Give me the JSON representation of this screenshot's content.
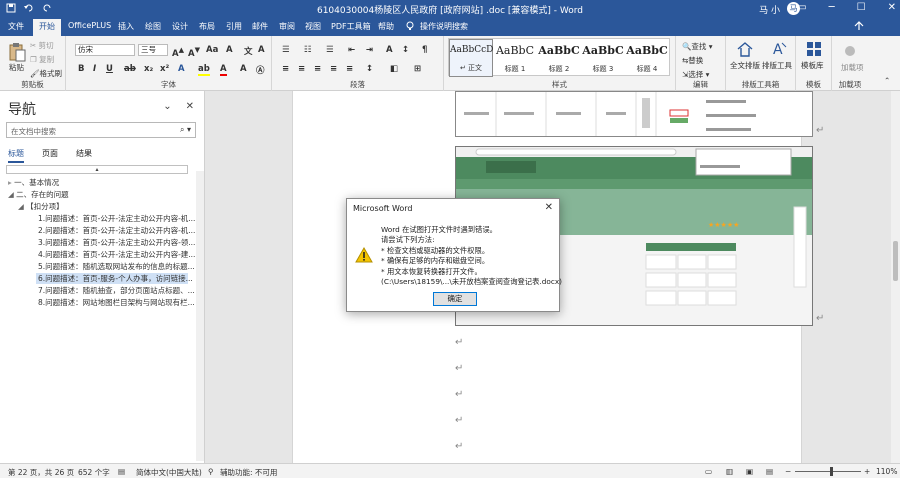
{
  "window": {
    "title": "6104030004杨陵区人民政府 [政府网站] .doc [兼容模式] - Word",
    "user": "马 小",
    "user_initial": "马"
  },
  "ribbon_tabs": [
    "文件",
    "开始",
    "OfficePLUS",
    "插入",
    "绘图",
    "设计",
    "布局",
    "引用",
    "邮件",
    "审阅",
    "视图",
    "PDF工具箱",
    "帮助",
    "操作说明搜索"
  ],
  "ribbon": {
    "clipboard": {
      "paste": "粘贴",
      "cut": "剪切",
      "copy": "复制",
      "format_painter": "格式刷",
      "label": "剪贴板"
    },
    "font": {
      "font_name": "仿宋",
      "font_size": "三号",
      "label": "字体"
    },
    "paragraph": {
      "label": "段落"
    },
    "styles": {
      "label": "样式",
      "items": [
        {
          "sample": "AaBbCcD",
          "name": "↵ 正文"
        },
        {
          "sample": "AaBbC",
          "name": "标题 1"
        },
        {
          "sample": "AaBbC",
          "name": "标题 2"
        },
        {
          "sample": "AaBbC",
          "name": "标题 3"
        },
        {
          "sample": "AaBbC",
          "name": "标题 4"
        }
      ]
    },
    "editing": {
      "find": "查找",
      "replace": "替换",
      "select": "选择",
      "label": "编辑"
    },
    "layout_tools": {
      "full_layout": "全文排版",
      "layout_tool": "排版工具",
      "label": "排版工具箱"
    },
    "template": {
      "template_lib": "模板库",
      "label": "模板"
    },
    "addins": {
      "load_item": "加载项",
      "label": "加载项"
    }
  },
  "nav": {
    "title": "导航",
    "search_placeholder": "在文档中搜索",
    "tabs": [
      "标题",
      "页面",
      "结果"
    ],
    "items": [
      "一、基本情况",
      "二、存在的问题",
      "【扣分项】",
      "1.问题描述：首页-公开-法定主动公开内容-机...",
      "2.问题描述：首页-公开-法定主动公开内容-机...",
      "3.问题描述：首页-公开-法定主动公开内容-领...",
      "4.问题描述：首页-公开-法定主动公开内容-建...",
      "5.问题描述：随机选取网站发布的信息的标题...",
      "6.问题描述：首页-服务-个人办事，访问链接...",
      "7.问题描述：随机抽查，部分页面站点标题、...",
      "8.问题描述：网站地图栏目架构与网站现有栏..."
    ]
  },
  "dialog": {
    "title": "Microsoft Word",
    "lines": [
      "Word 在试图打开文件时遇到错误。",
      "请尝试下列方法:",
      "* 检查文档或驱动器的文件权限。",
      "* 确保有足够的内存和磁盘空间。",
      "* 用文本恢复转换器打开文件。",
      "(C:\\Users\\18159\\...\\未开放档案查阅查询登记表.docx)"
    ],
    "ok_label": "确定"
  },
  "status": {
    "page": "第 22 页，共 26 页",
    "words": "652 个字",
    "language": "简体中文(中国大陆)",
    "accessibility": "辅助功能: 不可用",
    "zoom": "110%"
  },
  "colors": {
    "accent": "#2b579a",
    "dialog_button_border": "#0078d7",
    "warning": "#f4c400"
  }
}
